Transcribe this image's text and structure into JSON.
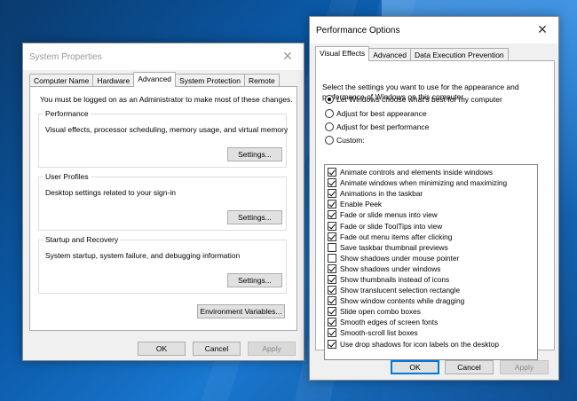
{
  "system_properties": {
    "title": "System Properties",
    "tabs": [
      "Computer Name",
      "Hardware",
      "Advanced",
      "System Protection",
      "Remote"
    ],
    "active_tab": "Advanced",
    "admin_notice": "You must be logged on as an Administrator to make most of these changes.",
    "performance": {
      "label": "Performance",
      "desc": "Visual effects, processor scheduling, memory usage, and virtual memory",
      "settings": "Settings..."
    },
    "user_profiles": {
      "label": "User Profiles",
      "desc": "Desktop settings related to your sign-in",
      "settings": "Settings..."
    },
    "startup_recovery": {
      "label": "Startup and Recovery",
      "desc": "System startup, system failure, and debugging information",
      "settings": "Settings..."
    },
    "env_vars": "Environment Variables...",
    "ok": "OK",
    "cancel": "Cancel",
    "apply": "Apply"
  },
  "performance_options": {
    "title": "Performance Options",
    "tabs": [
      "Visual Effects",
      "Advanced",
      "Data Execution Prevention"
    ],
    "active_tab": "Visual Effects",
    "intro": "Select the settings you want to use for the appearance and performance of Windows on this computer.",
    "radios": [
      {
        "label": "Let Windows choose what's best for my computer",
        "checked": true
      },
      {
        "label": "Adjust for best appearance",
        "checked": false
      },
      {
        "label": "Adjust for best performance",
        "checked": false
      },
      {
        "label": "Custom:",
        "checked": false
      }
    ],
    "effects": [
      {
        "label": "Animate controls and elements inside windows",
        "checked": true
      },
      {
        "label": "Animate windows when minimizing and maximizing",
        "checked": true
      },
      {
        "label": "Animations in the taskbar",
        "checked": true
      },
      {
        "label": "Enable Peek",
        "checked": true
      },
      {
        "label": "Fade or slide menus into view",
        "checked": true
      },
      {
        "label": "Fade or slide ToolTips into view",
        "checked": true
      },
      {
        "label": "Fade out menu items after clicking",
        "checked": true
      },
      {
        "label": "Save taskbar thumbnail previews",
        "checked": false
      },
      {
        "label": "Show shadows under mouse pointer",
        "checked": false
      },
      {
        "label": "Show shadows under windows",
        "checked": true
      },
      {
        "label": "Show thumbnails instead of icons",
        "checked": true
      },
      {
        "label": "Show translucent selection rectangle",
        "checked": true
      },
      {
        "label": "Show window contents while dragging",
        "checked": true
      },
      {
        "label": "Slide open combo boxes",
        "checked": true
      },
      {
        "label": "Smooth edges of screen fonts",
        "checked": true
      },
      {
        "label": "Smooth-scroll list boxes",
        "checked": true
      },
      {
        "label": "Use drop shadows for icon labels on the desktop",
        "checked": true
      }
    ],
    "ok": "OK",
    "cancel": "Cancel",
    "apply": "Apply"
  }
}
